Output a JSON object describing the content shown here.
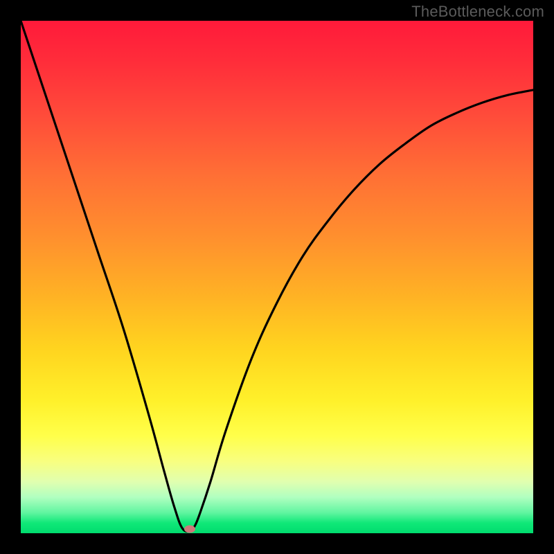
{
  "watermark": "TheBottleneck.com",
  "chart_data": {
    "type": "line",
    "title": "",
    "xlabel": "",
    "ylabel": "",
    "xlim": [
      0,
      100
    ],
    "ylim": [
      0,
      100
    ],
    "grid": false,
    "legend": false,
    "series": [
      {
        "name": "bottleneck-curve",
        "x": [
          0,
          5,
          10,
          15,
          20,
          25,
          28,
          30,
          31.5,
          33,
          34,
          35,
          37,
          40,
          45,
          50,
          55,
          60,
          65,
          70,
          75,
          80,
          85,
          90,
          95,
          100
        ],
        "y": [
          100,
          85,
          70,
          55,
          40,
          23,
          12,
          5,
          1,
          0.4,
          1.5,
          4,
          10,
          20,
          34,
          45,
          54,
          61,
          67,
          72,
          76,
          79.5,
          82,
          84,
          85.5,
          86.5
        ]
      }
    ],
    "marker": {
      "x": 33,
      "y": 0.8,
      "color": "#cc7a7a"
    },
    "background_gradient": {
      "top": "#ff1a3a",
      "mid": "#ffd41f",
      "bottom": "#00dc6e"
    }
  },
  "plot": {
    "inner_left": 30,
    "inner_top": 30,
    "inner_size": 740
  }
}
